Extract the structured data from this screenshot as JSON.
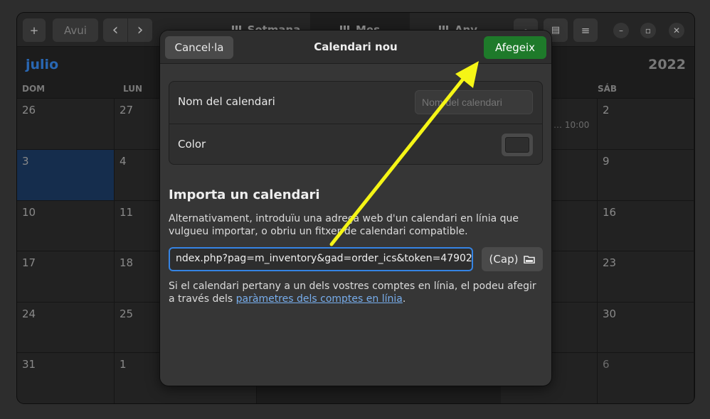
{
  "headerbar": {
    "new_event": "+",
    "today": "Avui",
    "prev": "‹",
    "next": "›",
    "views": [
      "Setmana",
      "Mes",
      "Any"
    ]
  },
  "calendar": {
    "month": "julio",
    "year": "2022",
    "day_names": [
      "DOM",
      "LUN",
      "SÁB"
    ],
    "left_col": [
      "26",
      "3",
      "10",
      "17",
      "24",
      "31"
    ],
    "col2": [
      "27",
      "4",
      "11",
      "18",
      "25",
      "1"
    ],
    "right_col": [
      "2",
      "9",
      "16",
      "23",
      "30",
      "6"
    ],
    "event_fragment": "… 10:00"
  },
  "dialog": {
    "title": "Calendari nou",
    "cancel": "Cancel·la",
    "add": "Afegeix",
    "name_label": "Nom del calendari",
    "name_placeholder": "Nom del calendari",
    "color_label": "Color",
    "import_title": "Importa un calendari",
    "import_desc": "Alternativament, introduïu una adreça web d'un calendari en línia que vulgueu importar, o obriu un fitxer de calendari compatible.",
    "url_value": "ndex.php?pag=m_inventory&gad=order_ics&token=47902",
    "file_button": "(Cap)",
    "accounts_note_pre": "Si el calendari pertany a un dels vostres comptes en línia, el podeu afegir a través dels ",
    "accounts_link": "paràmetres dels comptes en línia",
    "accounts_note_post": "."
  },
  "colors": {
    "accent": "#3584e4",
    "suggested": "#1e7a2a",
    "annotation": "#f5f516"
  }
}
